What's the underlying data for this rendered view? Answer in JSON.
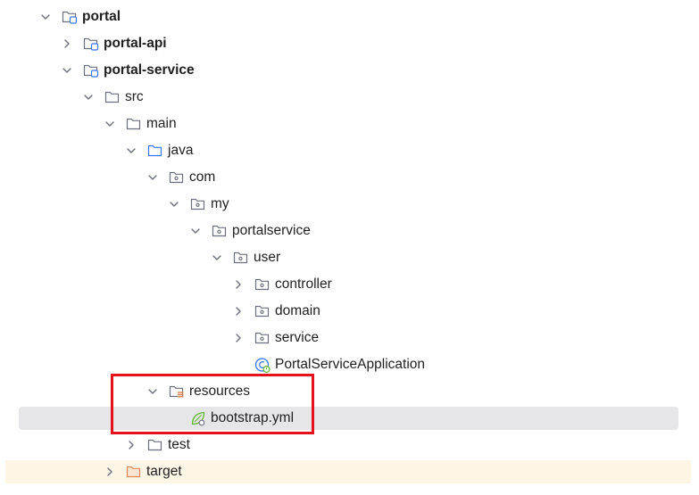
{
  "tree": {
    "nodes": [
      {
        "label": "portal",
        "depth": 0,
        "expanded": true,
        "icon": "module-folder-icon",
        "bold": true
      },
      {
        "label": "portal-api",
        "depth": 1,
        "expanded": false,
        "icon": "module-folder-icon",
        "bold": true
      },
      {
        "label": "portal-service",
        "depth": 1,
        "expanded": true,
        "icon": "module-folder-icon",
        "bold": true
      },
      {
        "label": "src",
        "depth": 2,
        "expanded": true,
        "icon": "folder-icon"
      },
      {
        "label": "main",
        "depth": 3,
        "expanded": true,
        "icon": "folder-icon"
      },
      {
        "label": "java",
        "depth": 4,
        "expanded": true,
        "icon": "source-folder-icon"
      },
      {
        "label": "com",
        "depth": 5,
        "expanded": true,
        "icon": "package-icon"
      },
      {
        "label": "my",
        "depth": 6,
        "expanded": true,
        "icon": "package-icon"
      },
      {
        "label": "portalservice",
        "depth": 7,
        "expanded": true,
        "icon": "package-icon"
      },
      {
        "label": "user",
        "depth": 8,
        "expanded": true,
        "icon": "package-icon"
      },
      {
        "label": "controller",
        "depth": 9,
        "expanded": false,
        "icon": "package-icon"
      },
      {
        "label": "domain",
        "depth": 9,
        "expanded": false,
        "icon": "package-icon"
      },
      {
        "label": "service",
        "depth": 9,
        "expanded": false,
        "icon": "package-icon"
      },
      {
        "label": "PortalServiceApplication",
        "depth": 9,
        "leaf": true,
        "icon": "spring-boot-class-icon"
      },
      {
        "label": "resources",
        "depth": 5,
        "expanded": true,
        "icon": "resources-folder-icon"
      },
      {
        "label": "bootstrap.yml",
        "depth": 6,
        "leaf": true,
        "icon": "spring-config-icon",
        "selected": true
      },
      {
        "label": "test",
        "depth": 4,
        "expanded": false,
        "icon": "folder-icon"
      },
      {
        "label": "target",
        "depth": 3,
        "expanded": false,
        "icon": "excluded-folder-icon",
        "excluded": true
      }
    ]
  },
  "colors": {
    "folder_stroke": "#6c707e",
    "source_folder_stroke": "#3574f0",
    "excluded_folder_stroke": "#e08855",
    "resource_bars": "#e08855",
    "spring_green": "#5fb832",
    "module_dot": "#3574f0",
    "selection_bg": "#e6e6e8",
    "excluded_row_bg": "#fdf6e6",
    "annotation_red": "#e5121d"
  }
}
